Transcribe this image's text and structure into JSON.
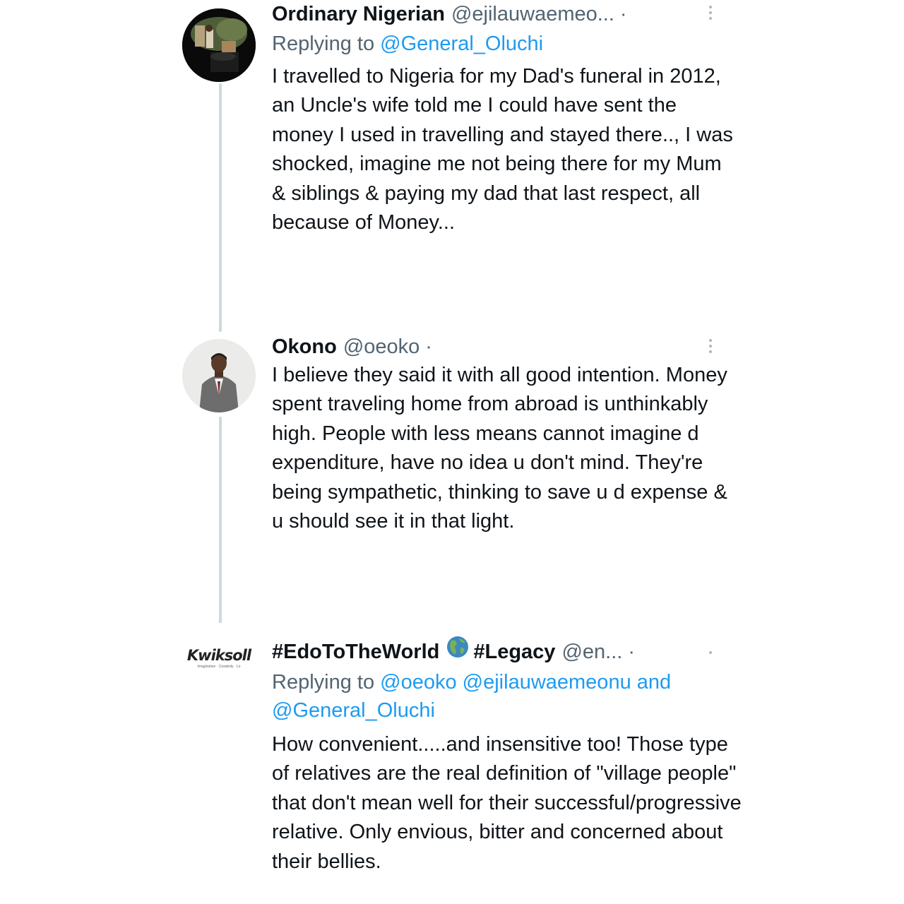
{
  "tweets": [
    {
      "display_name": "Ordinary Nigerian",
      "handle": "@ejilauwaemeo...",
      "separator": "·",
      "replying_prefix": "Replying to",
      "replying_to": "@General_Oluchi",
      "text": "I travelled to Nigeria for my Dad's funeral in 2012, an Uncle's wife told me I could have sent the money I used in travelling and stayed there.., I was shocked, imagine me not being there for my Mum & siblings & paying my dad that last respect, all because of Money..."
    },
    {
      "display_name": "Okono",
      "handle": "@oeoko",
      "separator": "·",
      "text": "I believe they said it with all good intention. Money spent traveling home from abroad is unthinkably high. People with less means cannot imagine d expenditure, have no idea u don't mind. They're being sympathetic, thinking to save u d expense & u should see it in that light."
    },
    {
      "display_name_part1": "#EdoToTheWorld",
      "display_name_part2": "#Legacy",
      "handle": "@en...",
      "separator": "·",
      "replying_prefix": "Replying to",
      "replying_to_1": "@oeoko",
      "replying_to_2": "@ejilauwaemeonu",
      "replying_joiner": "and",
      "replying_to_3": "@General_Oluchi",
      "avatar_logo_text": "Kwiksoll",
      "avatar_logo_tagline": "Imagination · Creativity · Le",
      "text": "How convenient.....and insensitive too! Those type of relatives are the real definition of \"village people\" that don't mean well for their successful/progressive relative. Only envious, bitter and concerned about their bellies."
    }
  ],
  "icons": {
    "more_options": "more-vertical-icon",
    "globe": "globe-americas-emoji"
  },
  "colors": {
    "text": "#0f1419",
    "secondary": "#536471",
    "link": "#1d9bf0",
    "thread_line": "#cfd9de"
  }
}
